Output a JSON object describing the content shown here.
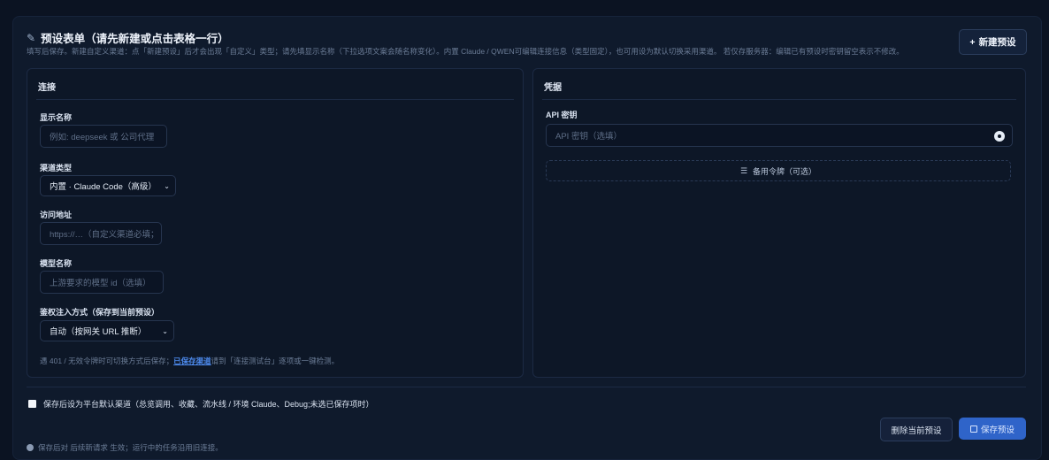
{
  "header": {
    "edit_icon": "✎",
    "title": "预设表单（请先新建或点击表格一行）",
    "subtitle": "填写后保存。新建自定义渠道：点「新建预设」后才会出现「自定义」类型；请先填显示名称（下拉选项文案会随名称变化）。内置 Claude / QWEN可编辑连接信息（类型固定），也可用设为默认切换采用渠道。 若仅存服务器：编辑已有预设时密钥留空表示不修改。",
    "new_button": "新建预设",
    "new_button_icon": "+"
  },
  "left_panel": {
    "heading": "连接",
    "display_name": {
      "label": "显示名称",
      "placeholder": "例如: deepseek 或 公司代理"
    },
    "channel_type": {
      "label": "渠道类型",
      "value": "内置 · Claude Code（高级）"
    },
    "endpoint": {
      "label": "访问地址",
      "placeholder": "https://…（自定义渠道必填；"
    },
    "model_name": {
      "label": "模型名称",
      "placeholder": "上游要求的模型 id（选填）"
    },
    "auth_mode": {
      "label": "鉴权注入方式（保存到当前预设）",
      "value": "自动（按网关 URL 推断）"
    },
    "hint_prefix": "遇 401 / 无效令牌时可切换方式后保存；",
    "hint_link": "已保存渠道",
    "hint_suffix": "请到「连接测试台」逐项或一键检测。"
  },
  "right_panel": {
    "heading": "凭据",
    "api_key": {
      "label": "API 密钥",
      "placeholder": "API 密钥（选填）"
    },
    "backup_tokens": "备用令牌（可选）",
    "backup_icon": "☰"
  },
  "default_checkbox": {
    "label": "保存后设为平台默认渠道（总览调用、收藏、流水线 / 环境 Claude、Debug;未选已保存项时）"
  },
  "footer": {
    "note": "保存后对 后续新请求 生效；运行中的任务沿用旧连接。"
  },
  "actions": {
    "delete": "删除当前预设",
    "save": "保存预设"
  },
  "colors": {
    "background": "#0b1322",
    "card": "#0f1a2c",
    "primary": "#2f64c9",
    "link": "#4e8cf0"
  }
}
